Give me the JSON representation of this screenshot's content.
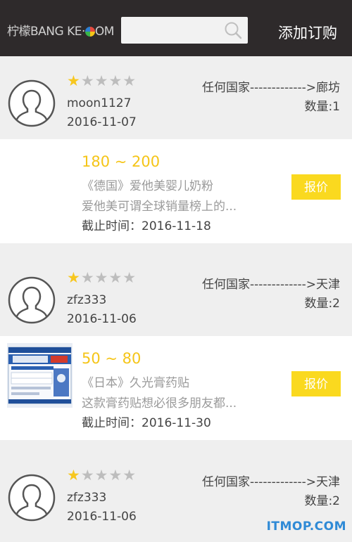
{
  "header": {
    "logo_text": "柠檬BANG KE·",
    "logo_suffix": "OM",
    "search_placeholder": "",
    "add_order_label": "添加订购"
  },
  "cards": [
    {
      "rating": 1,
      "username": "moon1127",
      "date": "2016-11-07",
      "route": "任何国家------------->廊坊",
      "quantity": "数量:1",
      "price": "180 ~ 200",
      "title": "《德国》爱他美婴儿奶粉",
      "description": "爱他美可谓全球销量榜上的...",
      "deadline": "截止时间：2016-11-18",
      "quote_label": "报价",
      "has_image": false
    },
    {
      "rating": 1,
      "username": "zfz333",
      "date": "2016-11-06",
      "route": "任何国家------------->天津",
      "quantity": "数量:2",
      "price": "50 ~ 80",
      "title": "《日本》久光膏药贴",
      "description": "这款膏药贴想必很多朋友都...",
      "deadline": "截止时间：2016-11-30",
      "quote_label": "报价",
      "has_image": true,
      "image_name": "patch-package-image"
    },
    {
      "rating": 1,
      "username": "zfz333",
      "date": "2016-11-06",
      "route": "任何国家------------->天津",
      "quantity": "数量:2"
    }
  ],
  "watermark": "ITMOP.COM",
  "colors": {
    "header_bg": "#2e2a2b",
    "accent_yellow": "#fad91f",
    "price_yellow": "#f5c518",
    "star_on": "#f7c71f",
    "star_off": "#bdbdbd"
  }
}
